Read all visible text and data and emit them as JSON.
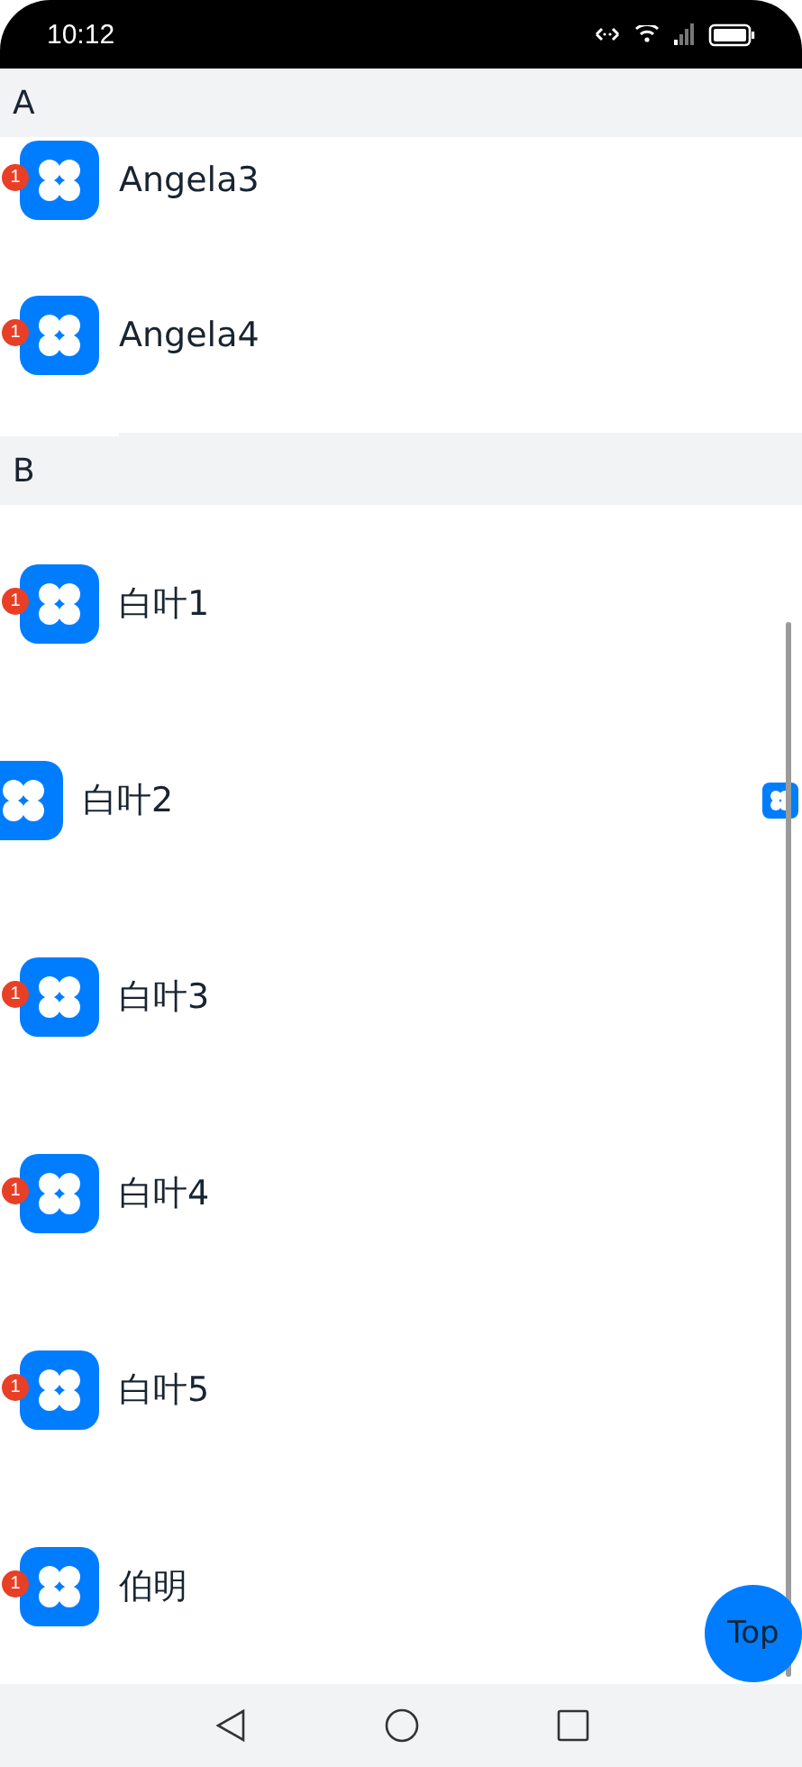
{
  "status_bar": {
    "time": "10:12"
  },
  "groups": [
    {
      "letter": "A",
      "items": [
        {
          "name": "Angela3",
          "badge": "1",
          "swiped": false,
          "compact": true
        },
        {
          "name": "Angela4",
          "badge": "1",
          "swiped": false,
          "compact": false
        }
      ]
    },
    {
      "letter": "B",
      "items": [
        {
          "name": "白叶1",
          "badge": "1",
          "swiped": false,
          "compact": false
        },
        {
          "name": "白叶2",
          "swiped": true,
          "compact": false
        },
        {
          "name": "白叶3",
          "badge": "1",
          "swiped": false,
          "compact": false
        },
        {
          "name": "白叶4",
          "badge": "1",
          "swiped": false,
          "compact": false
        },
        {
          "name": "白叶5",
          "badge": "1",
          "swiped": false,
          "compact": false
        },
        {
          "name": "伯明",
          "badge": "1",
          "swiped": false,
          "compact": false
        }
      ]
    }
  ],
  "top_button": {
    "label": "Top"
  }
}
